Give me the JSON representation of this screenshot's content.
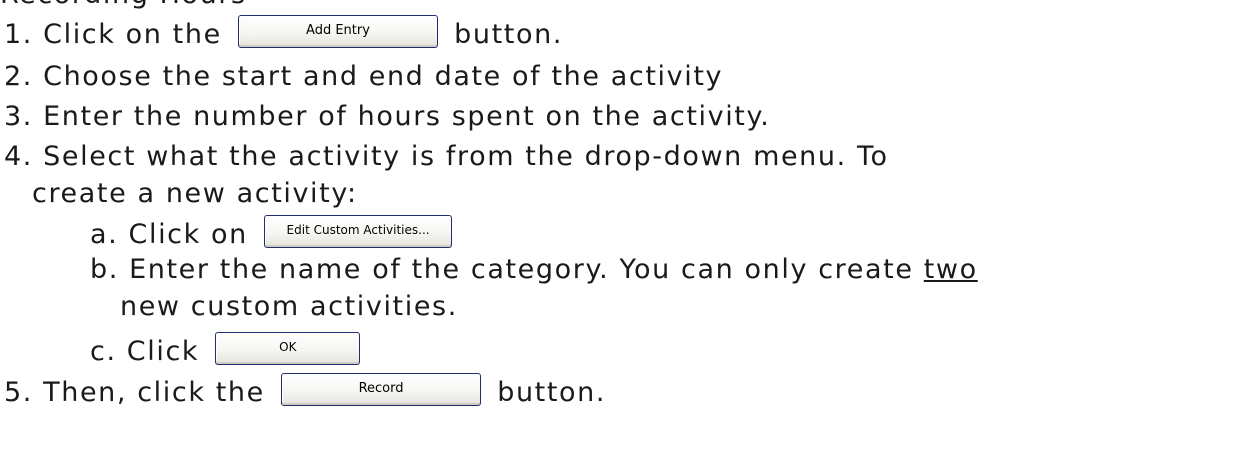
{
  "heading": "Recording Hours",
  "steps": {
    "s1_prefix": "1. Click on the",
    "s1_button": "Add Entry",
    "s1_suffix": "button.",
    "s2": "2. Choose the start and end date of the activity",
    "s3": "3. Enter the number of hours spent on the activity.",
    "s4_line1": "4. Select what the activity is from the drop-down menu.  To",
    "s4_line2": "create a new activity:",
    "sa_prefix": "a. Click on",
    "sa_button": "Edit Custom Activities...",
    "sb_line1_start": "b. Enter the name of the category.  You can only create",
    "sb_line1_underlined": "two",
    "sb_line2": "new custom activities.",
    "sc_prefix": "c. Click",
    "sc_button": "OK",
    "s5_prefix": "5. Then, click the",
    "s5_button": "Record",
    "s5_suffix": "button."
  }
}
